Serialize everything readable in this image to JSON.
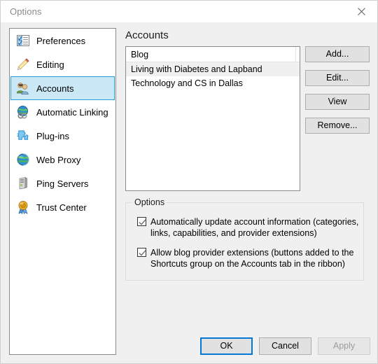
{
  "window": {
    "title": "Options",
    "close_icon": "close-icon"
  },
  "sidebar": {
    "items": [
      {
        "label": "Preferences",
        "icon": "checklist-icon",
        "selected": false
      },
      {
        "label": "Editing",
        "icon": "pencil-icon",
        "selected": false
      },
      {
        "label": "Accounts",
        "icon": "users-icon",
        "selected": true
      },
      {
        "label": "Automatic Linking",
        "icon": "globe-link-icon",
        "selected": false
      },
      {
        "label": "Plug-ins",
        "icon": "puzzle-piece-icon",
        "selected": false
      },
      {
        "label": "Web Proxy",
        "icon": "globe-icon",
        "selected": false
      },
      {
        "label": "Ping Servers",
        "icon": "server-icon",
        "selected": false
      },
      {
        "label": "Trust Center",
        "icon": "award-ribbon-icon",
        "selected": false
      }
    ]
  },
  "main": {
    "pane_title": "Accounts",
    "accounts_list": {
      "column_header": "Blog",
      "rows": [
        {
          "name": "Living with Diabetes and Lapband",
          "selected": true
        },
        {
          "name": "Technology and CS in Dallas",
          "selected": false
        }
      ]
    },
    "side_buttons": [
      {
        "label": "Add...",
        "enabled": true
      },
      {
        "label": "Edit...",
        "enabled": true
      },
      {
        "label": "View",
        "enabled": true
      },
      {
        "label": "Remove...",
        "enabled": true
      }
    ],
    "options_group": {
      "legend": "Options",
      "checkboxes": [
        {
          "label": "Automatically update account information (categories, links, capabilities, and provider extensions)",
          "checked": true
        },
        {
          "label": "Allow blog provider extensions (buttons added to the Shortcuts group on the Accounts tab in the ribbon)",
          "checked": true
        }
      ]
    }
  },
  "footer": {
    "buttons": [
      {
        "label": "OK",
        "state": "default"
      },
      {
        "label": "Cancel",
        "state": "normal"
      },
      {
        "label": "Apply",
        "state": "disabled"
      }
    ]
  },
  "colors": {
    "accent": "#0078d7",
    "selection_fill": "#cbe8f6",
    "selection_border": "#26a0da",
    "row_selection": "#f0f0f0",
    "dialog_bg": "#f0f0f0",
    "title_text": "#8a8a8a"
  }
}
